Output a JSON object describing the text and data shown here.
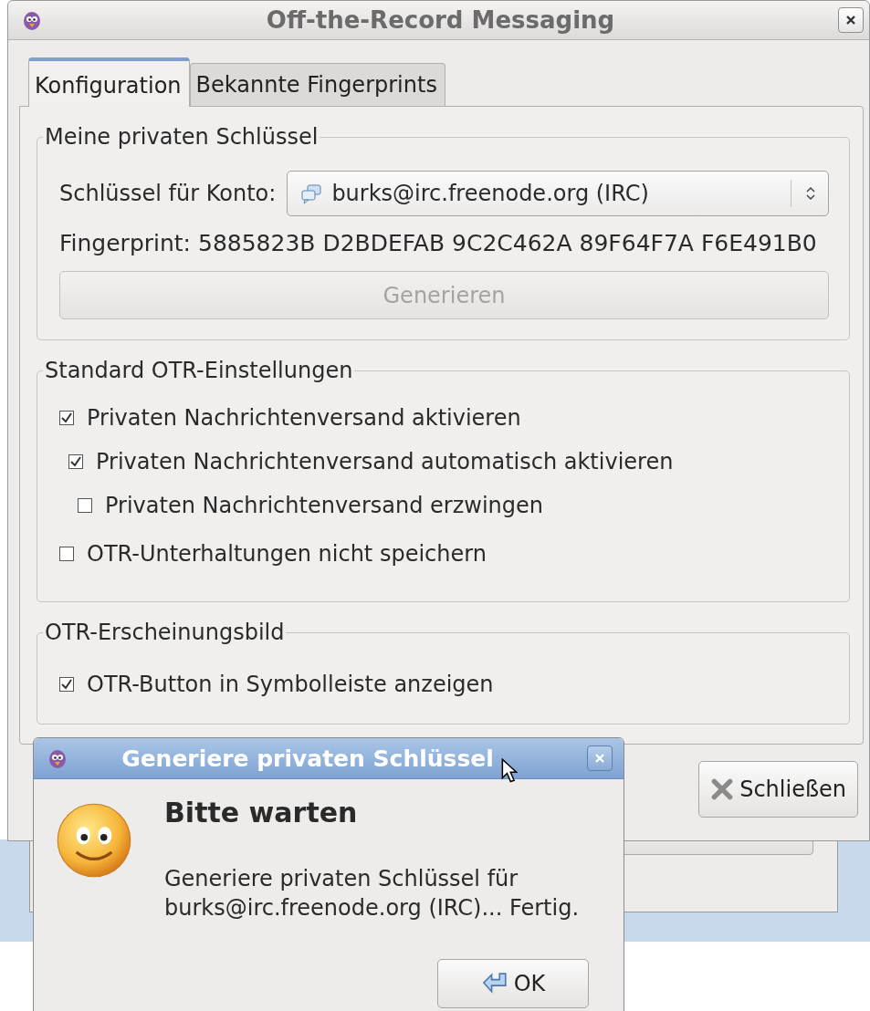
{
  "window": {
    "title": "Off-the-Record Messaging"
  },
  "tabs": [
    {
      "label": "Konfiguration",
      "selected": true
    },
    {
      "label": "Bekannte Fingerprints",
      "selected": false
    }
  ],
  "groups": [
    {
      "kind": "keys",
      "title": "Meine privaten Schlüssel",
      "account_label": "Schlüssel für Konto:",
      "account": "burks@irc.freenode.org (IRC)",
      "fingerprint": "Fingerprint: 5885823B D2BDEFAB 9C2C462A 89F64F7A F6E491B0",
      "generate_button": {
        "label": "Generieren",
        "disabled": true
      }
    },
    {
      "kind": "options",
      "title": "Standard OTR-Einstellungen",
      "options": [
        {
          "label": "Privaten Nachrichtenversand aktivieren",
          "checked": true,
          "children": [
            {
              "label": "Privaten Nachrichtenversand automatisch aktivieren",
              "checked": true,
              "children": [
                {
                  "label": "Privaten Nachrichtenversand erzwingen",
                  "checked": false
                }
              ]
            }
          ]
        },
        {
          "label": "OTR-Unterhaltungen nicht speichern",
          "checked": false
        }
      ]
    },
    {
      "kind": "options",
      "title": "OTR-Erscheinungsbild",
      "options": [
        {
          "label": "OTR-Button in Symbolleiste anzeigen",
          "checked": true
        }
      ]
    }
  ],
  "close_button": "Schließen",
  "dialog": {
    "title": "Generiere privaten Schlüssel",
    "heading": "Bitte warten",
    "message": "Generiere privaten Schlüssel für burks@irc.freenode.org (IRC)... Fertig.",
    "ok_button": "OK"
  }
}
